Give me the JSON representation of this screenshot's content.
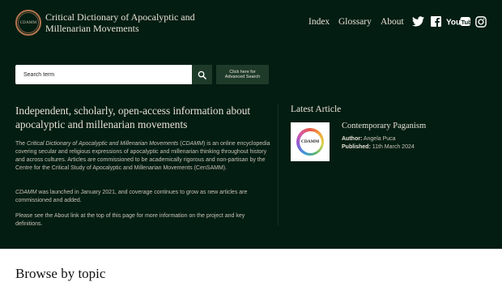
{
  "header": {
    "logo_text": "CDAMM",
    "site_title": "Critical Dictionary of Apocalyptic and Millenarian Movements",
    "nav": [
      {
        "label": "Index"
      },
      {
        "label": "Glossary"
      },
      {
        "label": "About"
      }
    ],
    "social_icons": [
      "twitter-icon",
      "facebook-icon",
      "youtube-icon",
      "instagram-icon"
    ],
    "youtube_label": "YouTube"
  },
  "search": {
    "placeholder": "Search term",
    "button_icon": "search-icon",
    "advanced_label": "Click here for Advanced Search"
  },
  "intro": {
    "heading": "Independent, scholarly, open-access information about apocalyptic and millenarian movements",
    "p1_prefix": "The ",
    "p1_title": "Critical Dictionary of Apocalyptic and Millenarian Movements",
    "p1_mid": " (",
    "p1_abbr": "CDAMM",
    "p1_rest": ") is an online encyclopedia covering secular and religious expressions of apocalyptic and millenarian thinking throughout history and across cultures. Articles are commissioned to be academically rigorous and non-partisan by the Centre for the Critical Study of Apocalyptic and Millenarian Movements (CenSAMM).",
    "p2_abbr": "CDAMM",
    "p2_rest": " was launched in January 2021, and coverage continues to grow as new articles are commissioned and added.",
    "p3": "Please see the About link at the top of this page for more information on the project and key definitions."
  },
  "latest": {
    "heading": "Latest Article",
    "thumb_text": "CDAMM",
    "title": "Contemporary Paganism",
    "author_label": "Author:",
    "author": "Angela Puca",
    "published_label": "Published:",
    "published": "11th March 2024"
  },
  "browse": {
    "heading": "Browse by topic"
  },
  "colors": {
    "hero_bg": "#031d12",
    "button_bg": "#1e3b2a",
    "logo_ring": "#b5754e",
    "text_light": "#e9e2d6"
  }
}
